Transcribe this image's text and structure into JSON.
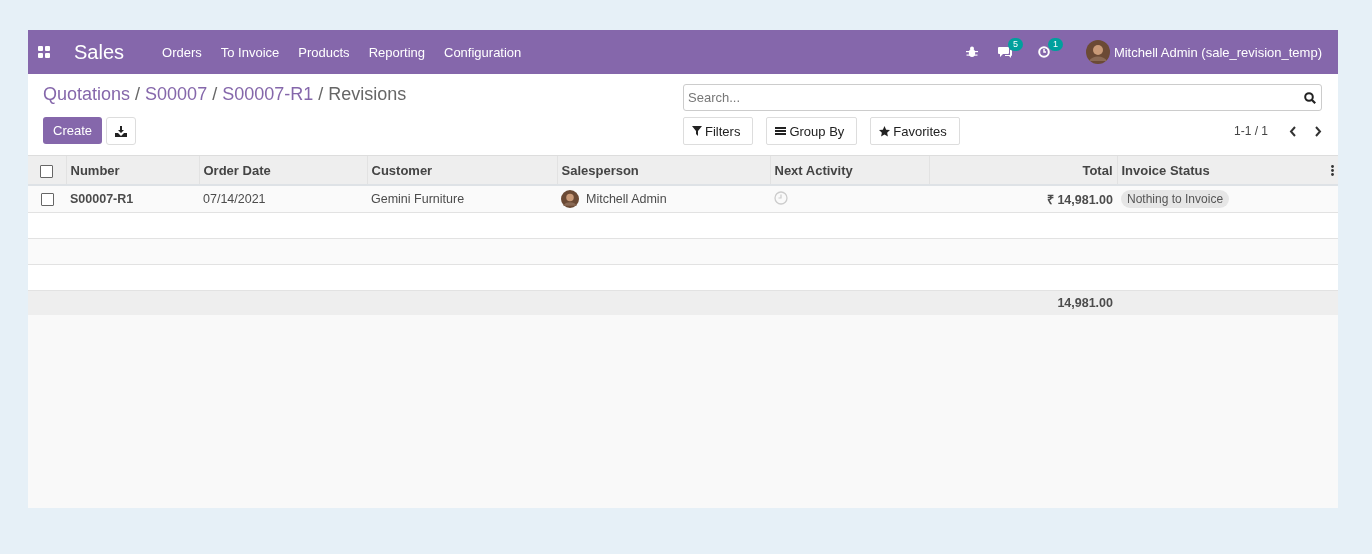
{
  "navbar": {
    "app_name": "Sales",
    "menu": [
      "Orders",
      "To Invoice",
      "Products",
      "Reporting",
      "Configuration"
    ],
    "messages_count": "5",
    "activities_count": "1",
    "user": "Mitchell Admin (sale_revision_temp)"
  },
  "breadcrumbs": [
    {
      "label": "Quotations",
      "current": false
    },
    {
      "separator": "/",
      "label": "S00007",
      "current": false
    },
    {
      "separator": "/",
      "label": "S00007-R1",
      "current": false
    },
    {
      "separator": "/",
      "label": "Revisions",
      "current": true
    }
  ],
  "create_button": "Create",
  "search": {
    "placeholder": "Search..."
  },
  "search_options": [
    {
      "kind": "filter",
      "label": "Filters"
    },
    {
      "kind": "group",
      "label": "Group By"
    },
    {
      "kind": "favorite",
      "label": "Favorites"
    }
  ],
  "pager": "1-1 / 1",
  "table": {
    "all_selected": false,
    "columns": [
      "Number",
      "Order Date",
      "Customer",
      "Salesperson",
      "Next Activity",
      "Total",
      "Invoice Status"
    ],
    "rows": [
      {
        "selected": false,
        "number": "S00007-R1",
        "order_date": "07/14/2021",
        "customer": "Gemini Furniture",
        "salesperson": "Mitchell Admin",
        "total": "₹ 14,981.00",
        "invoice_status": "Nothing to Invoice"
      }
    ],
    "footer_total": "14,981.00"
  }
}
